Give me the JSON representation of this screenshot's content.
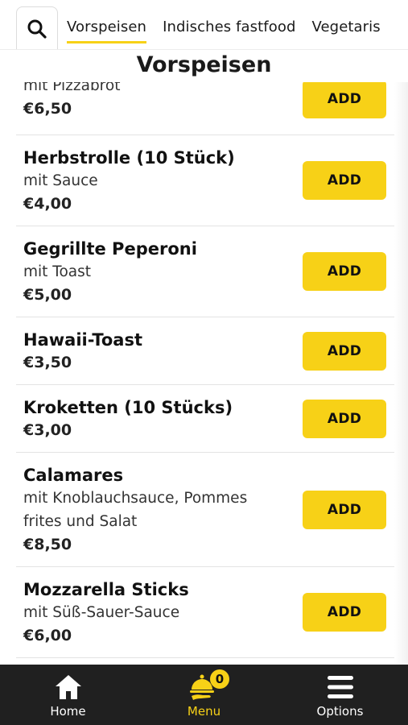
{
  "colors": {
    "accent": "#f7d117",
    "nav_background": "#202020"
  },
  "search": {
    "icon": "search-icon"
  },
  "tabs": [
    {
      "label": "Vorspeisen",
      "active": true
    },
    {
      "label": "Indisches fastfood",
      "active": false
    },
    {
      "label": "Vegetaris",
      "active": false
    }
  ],
  "section_title": "Vorspeisen",
  "add_label": "ADD",
  "items": [
    {
      "name": "",
      "desc": "mit Pizzabrot",
      "price": "€6,50"
    },
    {
      "name": "Herbstrolle (10 Stück)",
      "desc": "mit Sauce",
      "price": "€4,00"
    },
    {
      "name": "Gegrillte Peperoni",
      "desc": "mit Toast",
      "price": "€5,00"
    },
    {
      "name": "Hawaii-Toast",
      "desc": "",
      "price": "€3,50"
    },
    {
      "name": "Kroketten (10 Stücks)",
      "desc": "",
      "price": "€3,00"
    },
    {
      "name": "Calamares",
      "desc": "mit Knoblauchsauce, Pommes frites und Salat",
      "price": "€8,50"
    },
    {
      "name": "Mozzarella Sticks",
      "desc": "mit Süß-Sauer-Sauce",
      "price": "€6,00"
    }
  ],
  "bottom_nav": [
    {
      "label": "Home",
      "icon": "home-icon",
      "active": false
    },
    {
      "label": "Menu",
      "icon": "food-tray-icon",
      "active": true,
      "badge": "0"
    },
    {
      "label": "Options",
      "icon": "menu-bars-icon",
      "active": false
    }
  ]
}
